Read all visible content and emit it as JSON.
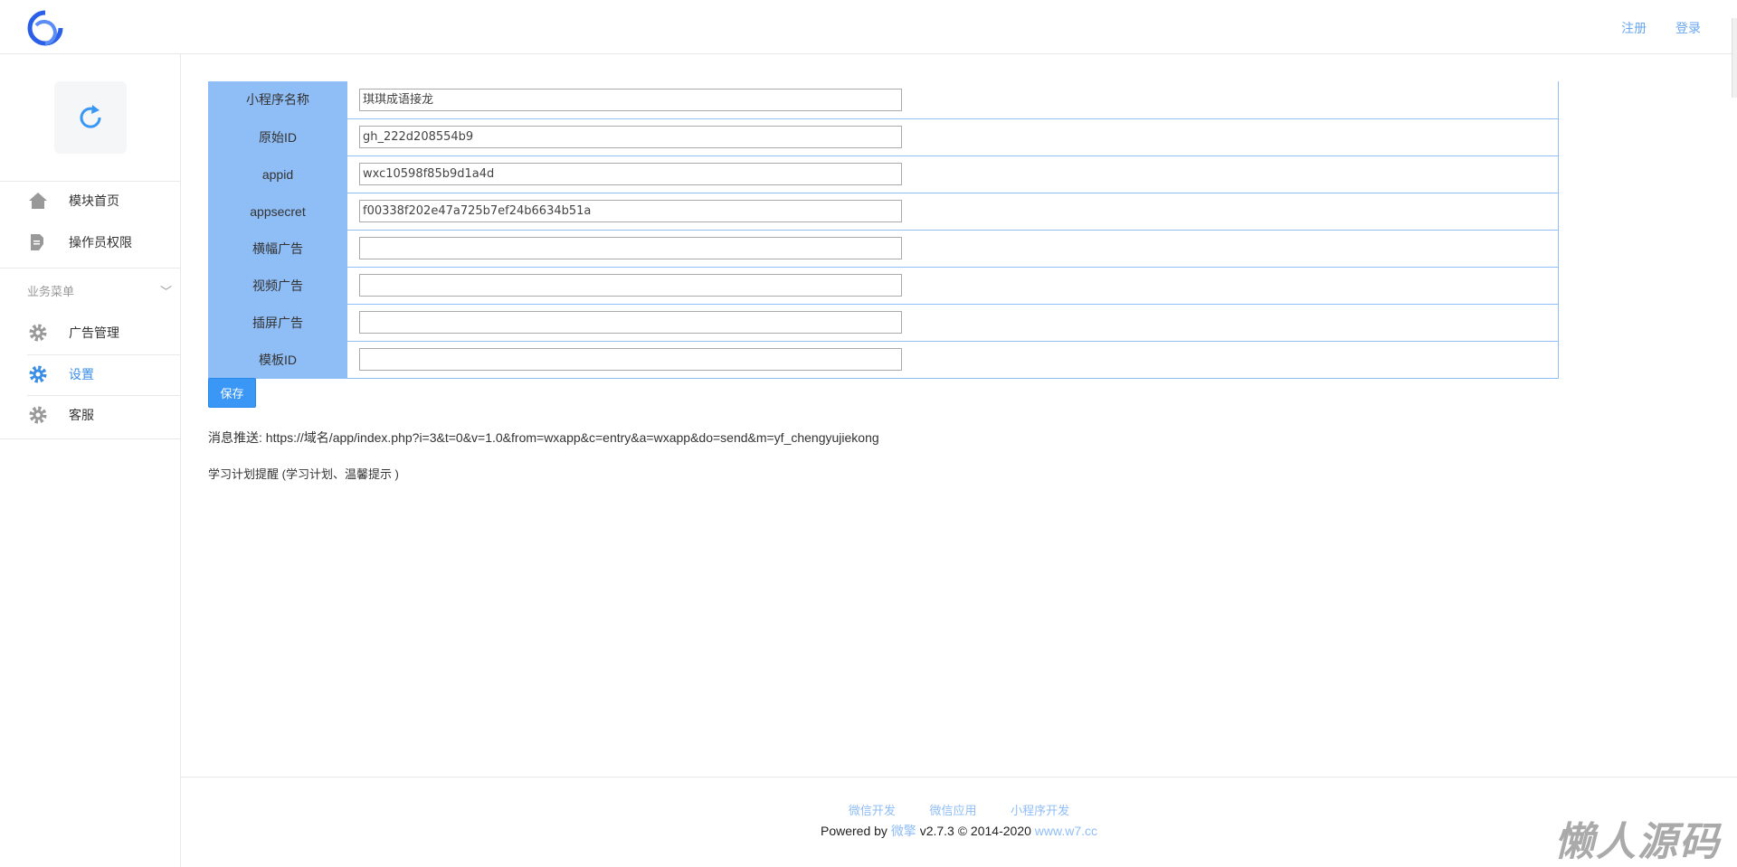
{
  "header": {
    "links": [
      "注册",
      "登录"
    ]
  },
  "sidebar": {
    "items": [
      {
        "label": "模块首页",
        "icon": "home-icon"
      },
      {
        "label": "操作员权限",
        "icon": "document-edit-icon"
      }
    ],
    "group_label": "业务菜单",
    "group_items": [
      {
        "label": "广告管理",
        "icon": "gear-icon"
      },
      {
        "label": "设置",
        "icon": "gear-icon",
        "active": true
      },
      {
        "label": "客服",
        "icon": "gear-icon"
      }
    ]
  },
  "form": {
    "rows": [
      {
        "label": "小程序名称",
        "value": "琪琪成语接龙"
      },
      {
        "label": "原始ID",
        "value": "gh_222d208554b9"
      },
      {
        "label": "appid",
        "value": "wxc10598f85b9d1a4d"
      },
      {
        "label": "appsecret",
        "value": "f00338f202e47a725b7ef24b6634b51a"
      },
      {
        "label": "横幅广告",
        "value": ""
      },
      {
        "label": "视频广告",
        "value": ""
      },
      {
        "label": "插屏广告",
        "value": ""
      },
      {
        "label": "模板ID",
        "value": ""
      }
    ],
    "save_label": "保存"
  },
  "notes": {
    "push": "消息推送: https://域名/app/index.php?i=3&t=0&v=1.0&from=wxapp&c=entry&a=wxapp&do=send&m=yf_chengyujiekong",
    "plan": "学习计划提醒 (学习计划、温馨提示 )"
  },
  "footer": {
    "links": [
      "微信开发",
      "微信应用",
      "小程序开发"
    ],
    "powered_prefix": "Powered by",
    "brand": "微擎",
    "version": "v2.7.3 © 2014-2020",
    "site": "www.w7.cc"
  },
  "watermark": "懒人源码",
  "colors": {
    "accent": "#3a97f5",
    "label_bg": "#8fbdf5"
  }
}
